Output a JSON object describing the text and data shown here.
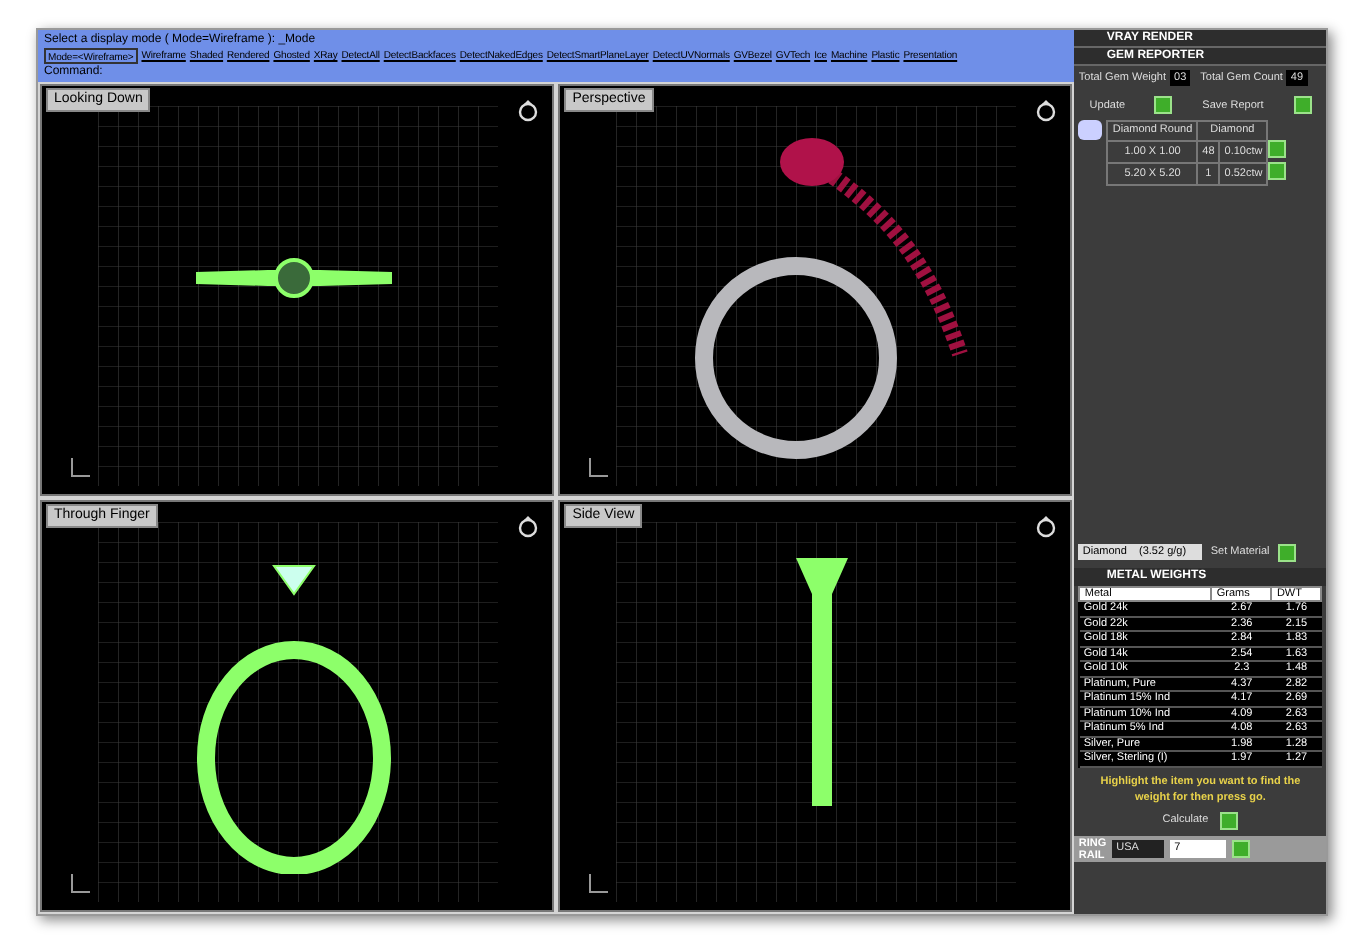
{
  "command_area": {
    "prompt": "Select a display mode ( Mode=Wireframe ): _Mode",
    "current": "Mode=<Wireframe>",
    "options": [
      "Wireframe",
      "Shaded",
      "Rendered",
      "Ghosted",
      "XRay",
      "DetectAll",
      "DetectBackfaces",
      "DetectNakedEdges",
      "DetectSmartPlaneLayer",
      "DetectUVNormals",
      "GVBezel",
      "GVTech",
      "Ice",
      "Machine",
      "Plastic",
      "Presentation"
    ],
    "command_label": "Command:"
  },
  "viewports": [
    {
      "title": "Looking Down",
      "kind": "top"
    },
    {
      "title": "Perspective",
      "kind": "perspective"
    },
    {
      "title": "Through Finger",
      "kind": "front"
    },
    {
      "title": "Side View",
      "kind": "side"
    }
  ],
  "panel": {
    "sections": [
      "VRAY RENDER",
      "GEM REPORTER"
    ],
    "gem_weight_label": "Total Gem Weight",
    "gem_weight": "03",
    "gem_count_label": "Total Gem Count",
    "gem_count": "49",
    "update_label": "Update",
    "save_label": "Save Report",
    "gem_columns": [
      "Diamond Round",
      "Diamond"
    ],
    "gem_rows": [
      [
        "1.00 X 1.00",
        "48",
        "0.10ctw"
      ],
      [
        "5.20 X 5.20",
        "1",
        "0.52ctw"
      ]
    ],
    "material": "Diamond    (3.52 g/g)",
    "set_material_label": "Set Material",
    "metal_title": "METAL WEIGHTS",
    "metal_columns": [
      "Metal",
      "Grams",
      "DWT"
    ],
    "metal_rows": [
      [
        "Gold 24k",
        "2.67",
        "1.76"
      ],
      [
        "Gold 22k",
        "2.36",
        "2.15"
      ],
      [
        "Gold 18k",
        "2.84",
        "1.83"
      ],
      [
        "Gold 14k",
        "2.54",
        "1.63"
      ],
      [
        "Gold 10k",
        "2.3",
        "1.48"
      ],
      [
        "Platinum, Pure",
        "4.37",
        "2.82"
      ],
      [
        "Platinum 15% Ind",
        "4.17",
        "2.69"
      ],
      [
        "Platinum 10% Ind",
        "4.09",
        "2.63"
      ],
      [
        "Platinum 5% Ind",
        "4.08",
        "2.63"
      ],
      [
        "Silver, Pure",
        "1.98",
        "1.28"
      ],
      [
        "Silver, Sterling (I)",
        "1.97",
        "1.27"
      ]
    ],
    "hint": "Highlight the item you want to find the weight for then press go.",
    "calculate_label": "Calculate",
    "ring_title_1": "RING",
    "ring_title_2": "RAIL",
    "ring_standard": "USA",
    "ring_size": "7"
  }
}
